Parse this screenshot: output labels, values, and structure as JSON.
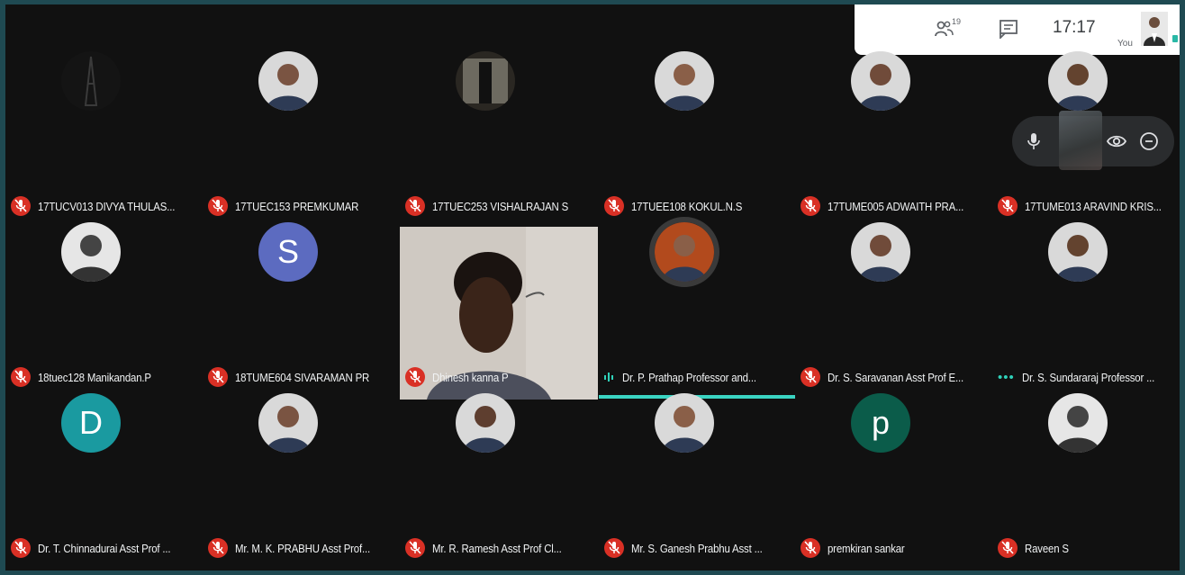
{
  "topbar": {
    "participants_count": "19",
    "time": "17:17",
    "you_label": "You"
  },
  "participants": [
    {
      "name": "17TUCV013 DIVYA THULAS...",
      "avatar": "photo-tower",
      "muted": true
    },
    {
      "name": "17TUEC153 PREMKUMAR",
      "avatar": "photo-person",
      "muted": true
    },
    {
      "name": "17TUEC253 VISHALRAJAN S",
      "avatar": "photo-door",
      "muted": true
    },
    {
      "name": "17TUEE108 KOKUL.N.S",
      "avatar": "photo-person",
      "muted": true
    },
    {
      "name": "17TUME005 ADWAITH PRA...",
      "avatar": "photo-person",
      "muted": true
    },
    {
      "name": "17TUME013 ARAVIND KRIS...",
      "avatar": "photo-person",
      "muted": true
    },
    {
      "name": "18tuec128 Manikandan.P",
      "avatar": "photo-bw",
      "muted": true
    },
    {
      "name": "18TUME604 SIVARAMAN PR",
      "avatar": "initial",
      "initial": "S",
      "color": "#5c6bc0",
      "muted": true
    },
    {
      "name": "Dhinesh kanna P",
      "avatar": "video",
      "muted": true
    },
    {
      "name": "Dr. P. Prathap Professor and...",
      "avatar": "photo-person",
      "muted": false,
      "speaking": true
    },
    {
      "name": "Dr. S. Saravanan Asst Prof E...",
      "avatar": "photo-person",
      "muted": true
    },
    {
      "name": "Dr. S. Sundararaj Professor ...",
      "avatar": "photo-person",
      "muted": false,
      "dots": true
    },
    {
      "name": "Dr. T. Chinnadurai Asst Prof ...",
      "avatar": "initial",
      "initial": "D",
      "color": "#1a9aa0",
      "muted": true
    },
    {
      "name": "Mr. M. K. PRABHU Asst Prof...",
      "avatar": "photo-person",
      "muted": true
    },
    {
      "name": "Mr. R. Ramesh Asst Prof Cl...",
      "avatar": "photo-person",
      "muted": true
    },
    {
      "name": "Mr. S. Ganesh Prabhu Asst ...",
      "avatar": "photo-person",
      "muted": true
    },
    {
      "name": "premkiran sankar",
      "avatar": "initial",
      "initial": "p",
      "color": "#0b5c4a",
      "muted": true
    },
    {
      "name": "Raveen S",
      "avatar": "photo-bw",
      "muted": true
    }
  ],
  "colors": {
    "mic_off": "#d93025",
    "speaking": "#2fd1b9",
    "background": "#111111"
  }
}
